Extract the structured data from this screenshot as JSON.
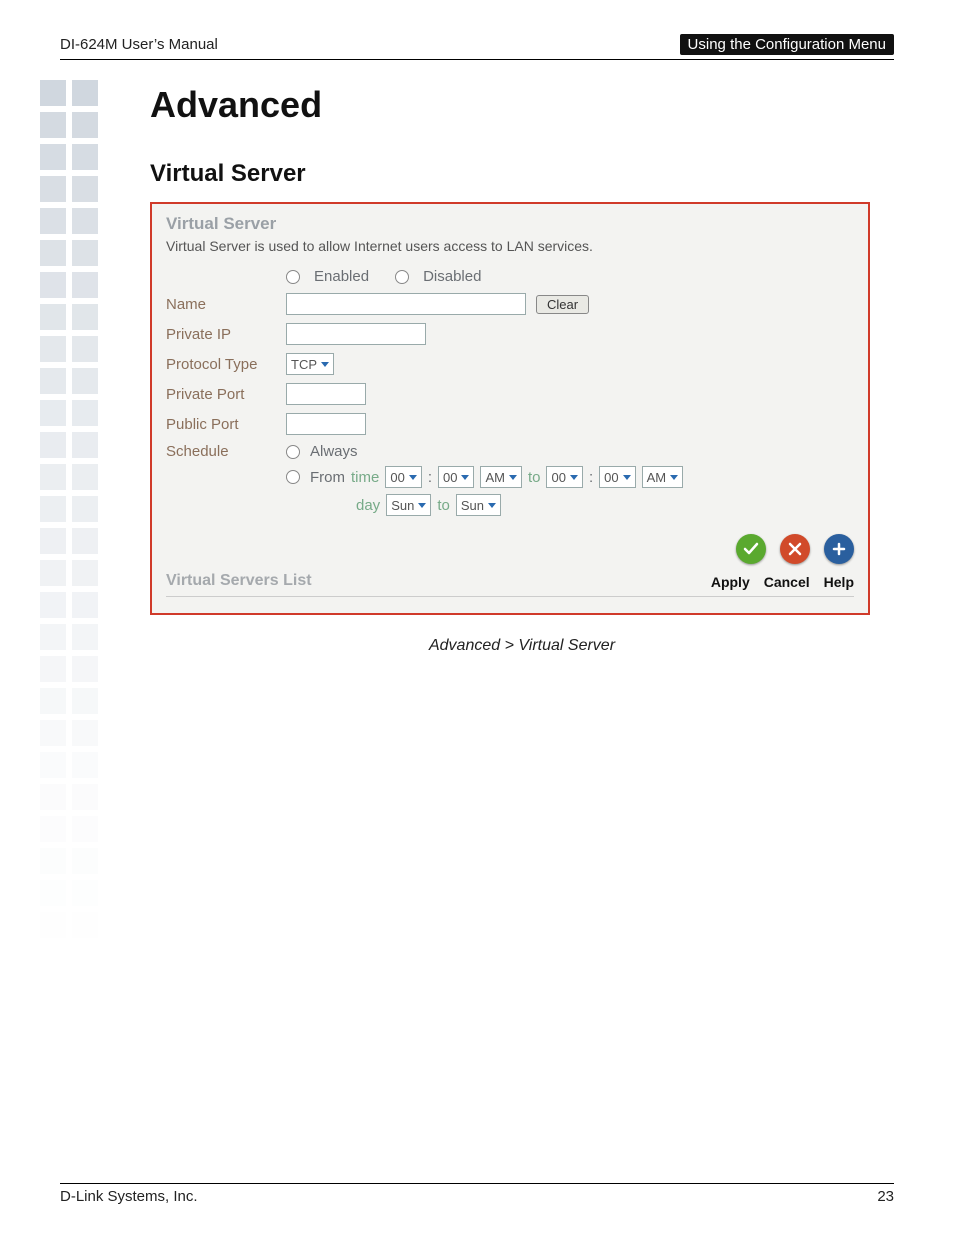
{
  "header": {
    "left": "DI-624M User’s Manual",
    "right": "Using the Configuration Menu"
  },
  "section_title": "Advanced",
  "subsection_title": "Virtual Server",
  "panel": {
    "title": "Virtual Server",
    "description": "Virtual Server is used to allow Internet users access to LAN services.",
    "enabled_label": "Enabled",
    "disabled_label": "Disabled",
    "name_label": "Name",
    "clear_btn": "Clear",
    "private_ip_label": "Private IP",
    "protocol_type_label": "Protocol Type",
    "protocol_value": "TCP",
    "private_port_label": "Private Port",
    "public_port_label": "Public Port",
    "schedule_label": "Schedule",
    "schedule_always": "Always",
    "schedule_from": "From",
    "time_label": "time",
    "to_label": "to",
    "day_label": "day",
    "hour1": "00",
    "min1": "00",
    "ampm1": "AM",
    "hour2": "00",
    "min2": "00",
    "ampm2": "AM",
    "day1": "Sun",
    "day2": "Sun",
    "list_title": "Virtual Servers List",
    "apply_label": "Apply",
    "cancel_label": "Cancel",
    "help_label": "Help"
  },
  "caption": "Advanced > Virtual Server",
  "footer": {
    "left": "D-Link Systems, Inc.",
    "right": "23"
  }
}
